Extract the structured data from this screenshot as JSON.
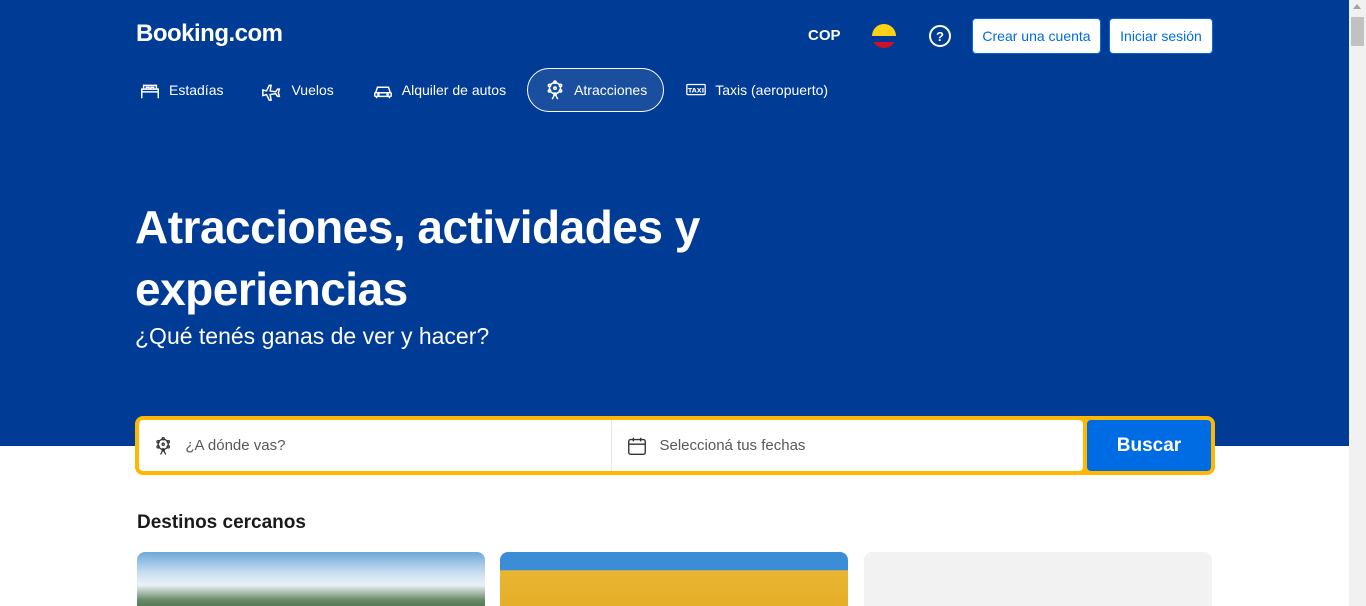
{
  "header": {
    "logo": "Booking.com",
    "currency": "COP",
    "flag": "colombia-flag",
    "help_icon": "question-circle-icon",
    "register_label": "Crear una cuenta",
    "login_label": "Iniciar sesión"
  },
  "nav": {
    "items": [
      {
        "label": "Estadías",
        "icon": "bed-icon"
      },
      {
        "label": "Vuelos",
        "icon": "plane-icon"
      },
      {
        "label": "Alquiler de autos",
        "icon": "car-icon"
      },
      {
        "label": "Atracciones",
        "icon": "ferris-wheel-icon",
        "active": true
      },
      {
        "label": "Taxis (aeropuerto)",
        "icon": "taxi-icon"
      }
    ]
  },
  "hero": {
    "title": "Atracciones, actividades y experiencias",
    "subtitle": "¿Qué tenés ganas de ver y hacer?"
  },
  "search": {
    "destination_placeholder": "¿A dónde vas?",
    "dates_placeholder": "Seleccioná tus fechas",
    "button_label": "Buscar"
  },
  "section": {
    "title": "Destinos cercanos"
  },
  "colors": {
    "brand_blue": "#003b95",
    "accent_blue": "#006ce4",
    "search_border": "#ffb700"
  }
}
